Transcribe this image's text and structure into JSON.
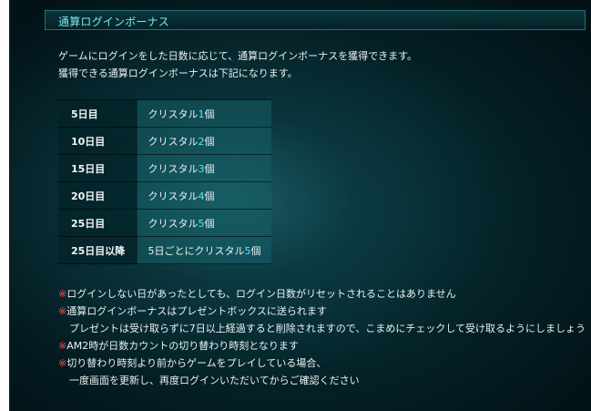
{
  "section": {
    "title": "通算ログインボーナス"
  },
  "intro": {
    "line1": "ゲームにログインをした日数に応じて、通算ログインボーナスを獲得できます。",
    "line2": "獲得できる通算ログインボーナスは下記になります。"
  },
  "rewards": [
    {
      "day": "5日目",
      "prefix": "クリスタル",
      "count": "1",
      "suffix": "個"
    },
    {
      "day": "10日目",
      "prefix": "クリスタル",
      "count": "2",
      "suffix": "個"
    },
    {
      "day": "15日目",
      "prefix": "クリスタル",
      "count": "3",
      "suffix": "個"
    },
    {
      "day": "20日目",
      "prefix": "クリスタル",
      "count": "4",
      "suffix": "個"
    },
    {
      "day": "25日目",
      "prefix": "クリスタル",
      "count": "5",
      "suffix": "個"
    },
    {
      "day": "25日目以降",
      "prefix": "5日ごとにクリスタル",
      "count": "5",
      "suffix": "個"
    }
  ],
  "notes": {
    "mark": "※",
    "line1": "ログインしない日があったとしても、ログイン日数がリセットされることはありません",
    "line2": "通算ログインボーナスはプレゼントボックスに送られます",
    "line3": "プレゼントは受け取らずに7日以上経過すると削除されますので、こまめにチェックして受け取るようにしましょう",
    "line4": "AM2時が日数カウントの切り替わり時刻となります",
    "line5": "切り替わり時刻より前からゲームをプレイしている場合、",
    "line6": "一度画面を更新し、再度ログインいただいてからご確認ください"
  },
  "colors": {
    "title": "#7ee6f2",
    "count": "#63e3ec",
    "note_mark": "#ff4a4a",
    "text": "#e8f2f2"
  }
}
